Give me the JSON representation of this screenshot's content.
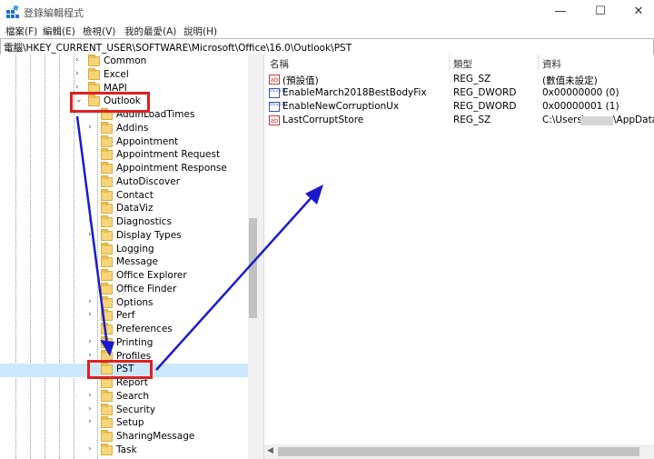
{
  "window": {
    "title": "登錄編輯程式",
    "minimize_glyph": "—",
    "maximize_glyph": "☐",
    "close_glyph": "✕"
  },
  "menu": [
    "檔案(F)",
    "編輯(E)",
    "檢視(V)",
    "我的最愛(A)",
    "說明(H)"
  ],
  "address": "電腦\\HKEY_CURRENT_USER\\SOFTWARE\\Microsoft\\Office\\16.0\\Outlook\\PST",
  "tree": {
    "expanded_glyph": "⌄",
    "collapsed_glyph": "›",
    "top_nodes": [
      {
        "label": "Common",
        "expandable": true
      },
      {
        "label": "Excel",
        "expandable": true
      },
      {
        "label": "MAPI",
        "expandable": true
      },
      {
        "label": "Outlook",
        "expandable": true,
        "expanded": true,
        "highlighted": true
      }
    ],
    "outlook_children": [
      {
        "label": "AddInLoadTimes",
        "expandable": false
      },
      {
        "label": "Addins",
        "expandable": true
      },
      {
        "label": "Appointment",
        "expandable": false
      },
      {
        "label": "Appointment Request",
        "expandable": false
      },
      {
        "label": "Appointment Response",
        "expandable": false
      },
      {
        "label": "AutoDiscover",
        "expandable": false
      },
      {
        "label": "Contact",
        "expandable": false
      },
      {
        "label": "DataViz",
        "expandable": true
      },
      {
        "label": "Diagnostics",
        "expandable": true
      },
      {
        "label": "Display Types",
        "expandable": true
      },
      {
        "label": "Logging",
        "expandable": false
      },
      {
        "label": "Message",
        "expandable": false
      },
      {
        "label": "Office Explorer",
        "expandable": false
      },
      {
        "label": "Office Finder",
        "expandable": false
      },
      {
        "label": "Options",
        "expandable": true
      },
      {
        "label": "Perf",
        "expandable": true
      },
      {
        "label": "Preferences",
        "expandable": false
      },
      {
        "label": "Printing",
        "expandable": true
      },
      {
        "label": "Profiles",
        "expandable": true
      },
      {
        "label": "PST",
        "expandable": false,
        "selected": true,
        "highlighted": true
      },
      {
        "label": "Report",
        "expandable": false
      },
      {
        "label": "Search",
        "expandable": true
      },
      {
        "label": "Security",
        "expandable": true
      },
      {
        "label": "Setup",
        "expandable": true
      },
      {
        "label": "SharingMessage",
        "expandable": false
      },
      {
        "label": "Task",
        "expandable": true
      }
    ]
  },
  "values_pane": {
    "columns": [
      "名稱",
      "類型",
      "資料"
    ],
    "rows": [
      {
        "icon": "string-value-icon",
        "icon_text": "ab",
        "name": "(預設值)",
        "type": "REG_SZ",
        "data": "(數值未設定)"
      },
      {
        "icon": "binary-value-icon",
        "icon_text": "011\n110",
        "name": "EnableMarch2018BestBodyFix",
        "type": "REG_DWORD",
        "data": "0x00000000 (0)"
      },
      {
        "icon": "binary-value-icon",
        "icon_text": "011\n110",
        "name": "EnableNewCorruptionUx",
        "type": "REG_DWORD",
        "data": "0x00000001 (1)"
      },
      {
        "icon": "string-value-icon",
        "icon_text": "ab",
        "name": "LastCorruptStore",
        "type": "REG_SZ",
        "data_prefix": "C:\\Users\\",
        "data_suffix": "\\AppData\\"
      }
    ]
  },
  "colors": {
    "annotation_red": "#e02020",
    "annotation_blue": "#1a1acc"
  }
}
